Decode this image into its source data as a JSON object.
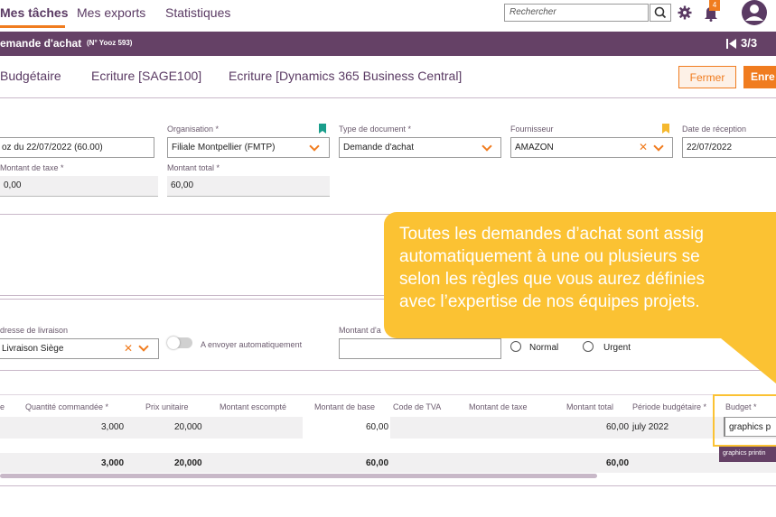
{
  "nav": {
    "tabs": [
      "Mes tâches",
      "Mes exports",
      "Statistiques"
    ],
    "search_placeholder": "Rechercher",
    "notification_count": "4"
  },
  "header": {
    "title": "emande d'achat",
    "subtitle": "(N° Yooz 593)",
    "pager": "3/3"
  },
  "subtabs": [
    "Budgétaire",
    "Ecriture [SAGE100]",
    "Ecriture [Dynamics 365 Business Central]"
  ],
  "actions": {
    "close": "Fermer",
    "save": "Enre"
  },
  "form": {
    "doc_value": "oz du 22/07/2022 (60.00)",
    "organisation_label": "Organisation *",
    "organisation_value": "Filiale Montpellier (FMTP)",
    "doctype_label": "Type de document *",
    "doctype_value": "Demande d'achat",
    "supplier_label": "Fournisseur",
    "supplier_value": "AMAZON",
    "reception_label": "Date de réception",
    "reception_value": "22/07/2022",
    "tax_label": "Montant de taxe *",
    "tax_value": "0,00",
    "total_label": "Montant total *",
    "total_value": "60,00",
    "delivery_label": "dresse de livraison",
    "delivery_value": "Livraison Siège",
    "auto_send_label": "A envoyer automatiquement",
    "amount_label": "Montant d'a",
    "priority": [
      "Normal",
      "Urgent"
    ]
  },
  "callout": {
    "lines": [
      "Toutes les demandes d’achat sont assig",
      "automatiquement à une ou plusieurs se",
      "selon les règles que vous aurez définies",
      "avec l’expertise de nos équipes projets."
    ]
  },
  "table": {
    "headers": [
      "e",
      "Quantité commandée *",
      "Prix unitaire",
      "Montant escompté",
      "Montant de base",
      "Code de TVA",
      "Montant de taxe",
      "Montant total",
      "Période budgétaire *",
      "Budget *"
    ],
    "row": {
      "qty": "3,000",
      "price": "20,000",
      "base": "60,00",
      "total": "60,00",
      "period": "july 2022",
      "budget": "graphics p"
    },
    "totals": {
      "qty": "3,000",
      "price": "20,000",
      "base": "60,00",
      "total": "60,00"
    },
    "tooltip": "graphics printin"
  },
  "colors": {
    "accent": "#f07c1f",
    "brand": "#654166",
    "callout": "#fbc233"
  }
}
